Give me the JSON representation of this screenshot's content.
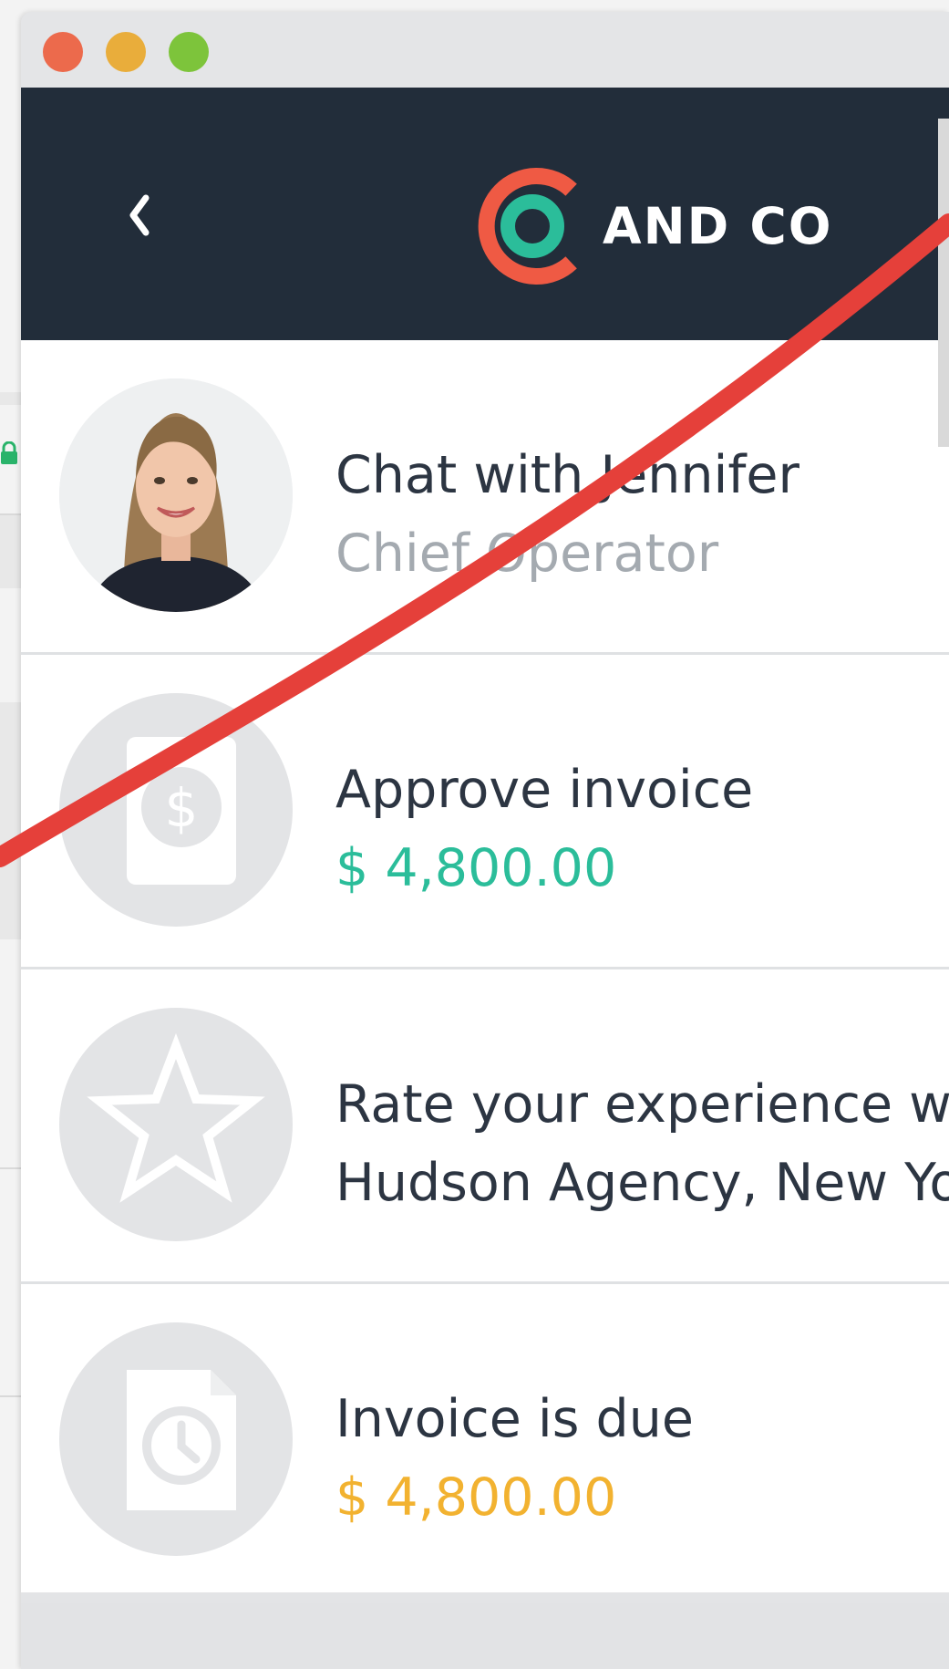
{
  "window": {
    "controls": [
      "close",
      "minimize",
      "zoom"
    ]
  },
  "header": {
    "back_icon": "chevron-left-icon",
    "logo_text": "AND CO",
    "logo_colors": {
      "ring": "#ef5a44",
      "inner": "#2bbd9a"
    }
  },
  "items": [
    {
      "title": "Chat with Jennifer",
      "subtitle": "Chief Operator",
      "icon": "avatar-photo",
      "subtitle_color": "#a4aab0"
    },
    {
      "title": "Approve invoice",
      "subtitle": "$ 4,800.00",
      "icon": "invoice-dollar-icon",
      "subtitle_color": "#2bbd9a"
    },
    {
      "title": "Rate your experience with",
      "subtitle": "Hudson Agency, New York",
      "icon": "star-icon",
      "subtitle_color": "#2c3542"
    },
    {
      "title": "Invoice is due",
      "subtitle": "$ 4,800.00",
      "icon": "invoice-clock-icon",
      "subtitle_color": "#f2b230"
    }
  ],
  "annotation": {
    "color": "#e5403a",
    "shape": "strike-line"
  },
  "colors": {
    "header_bg": "#222d3a",
    "accent_green": "#2bbd9a",
    "accent_yellow": "#f2b230"
  }
}
